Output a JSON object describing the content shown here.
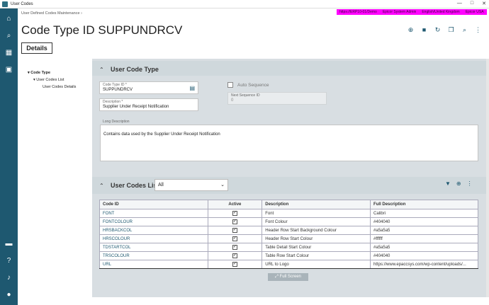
{
  "window": {
    "title": "User Codes",
    "controls": [
      "—",
      "□",
      "✕"
    ]
  },
  "rail": {
    "icons": [
      "home-icon",
      "search-icon",
      "apps-icon",
      "dashboard-icon",
      "chat-icon",
      "help-icon",
      "bell-icon",
      "user-icon"
    ]
  },
  "header": {
    "breadcrumb": "User Defined Codes Maintenance  ›",
    "env": [
      "https://ERP10-01/Demo",
      "Epicor System Admin",
      "English/United Kingdom",
      "Epicor USA"
    ],
    "title": "Code Type ID SUPPUNDRCV",
    "tab_details": "Details"
  },
  "tree": {
    "root": "Code Type",
    "child": "User Codes List",
    "grandchild": "User Codes Details"
  },
  "panel1": {
    "title": "User Code Type",
    "code_type_label": "Code Type ID *",
    "code_type_value": "SUPPUNDRCV",
    "description_label": "Description *",
    "description_value": "Supplier Under Receipt Notification",
    "auto_sequence_label": "Auto Sequence",
    "next_seq_label": "Next Sequence ID",
    "next_seq_value": "0",
    "long_desc_label": "Long Description",
    "long_desc_value": "Contains data used by the Supplier Under Receipt Notification"
  },
  "panel2": {
    "title": "User Codes List",
    "filter_value": "All",
    "columns": [
      "Code ID",
      "Active",
      "Description",
      "Full Description"
    ],
    "rows": [
      {
        "code": "FONT",
        "active": true,
        "desc": "Font",
        "full": "Calibri"
      },
      {
        "code": "FONTCOLOUR",
        "active": true,
        "desc": "Font Colour",
        "full": "#404040"
      },
      {
        "code": "HRSBACKCOL",
        "active": true,
        "desc": "Header Row Start Background Colour",
        "full": "#a5a5a5"
      },
      {
        "code": "HRSCOLOUR",
        "active": true,
        "desc": "Header Row Start Colour",
        "full": "#ffffff"
      },
      {
        "code": "TDSTARTCOL",
        "active": true,
        "desc": "Table Detail Start Colour",
        "full": "#a5a5a5"
      },
      {
        "code": "TRSCOLOUR",
        "active": true,
        "desc": "Table Row Start Colour",
        "full": "#404040"
      },
      {
        "code": "URL",
        "active": true,
        "desc": "URL to Logo",
        "full": "https://www.epaccsys.com/wp-content/uploads/..."
      }
    ],
    "full_screen_label": "Full Screen"
  }
}
